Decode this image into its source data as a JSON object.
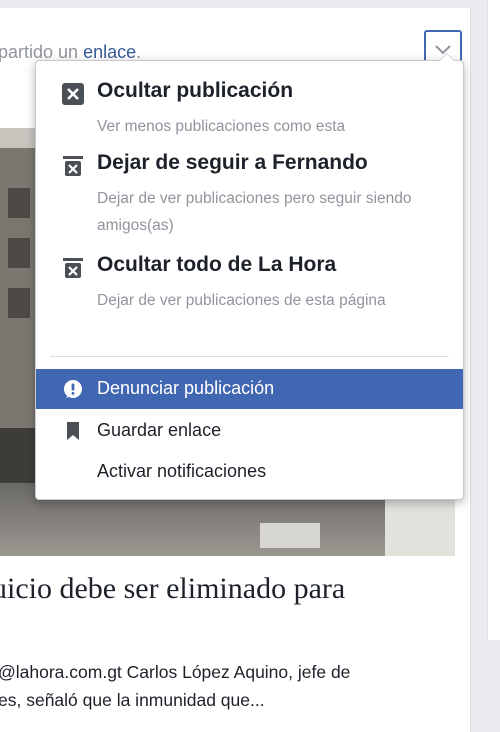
{
  "post": {
    "shared_prefix": "partido un ",
    "shared_link": "enlace",
    "shared_suffix": ".",
    "headline": "uicio debe ser eliminado para",
    "summary_line1": "@lahora.com.gt Carlos López Aquino, jefe de",
    "summary_line2": "es, señaló que la inmunidad que..."
  },
  "menu": {
    "hide_post": {
      "title": "Ocultar publicación",
      "sub": "Ver menos publicaciones como esta"
    },
    "unfollow": {
      "title": "Dejar de seguir a Fernando",
      "sub": "Dejar de ver publicaciones pero seguir siendo amigos(as)"
    },
    "hide_all": {
      "title": "Ocultar todo de La Hora",
      "sub": "Dejar de ver publicaciones de esta página"
    },
    "report": "Denunciar publicación",
    "save": "Guardar enlace",
    "notifications": "Activar notificaciones"
  },
  "icons": {
    "options": "chevron-down-icon",
    "hide": "hide-x-icon",
    "unfollow": "unfollow-icon",
    "hide_all": "hide-all-icon",
    "report": "report-exclamation-icon",
    "save": "bookmark-icon"
  },
  "colors": {
    "accent": "#4267b2",
    "link": "#365899",
    "secondary_text": "#90949c"
  }
}
